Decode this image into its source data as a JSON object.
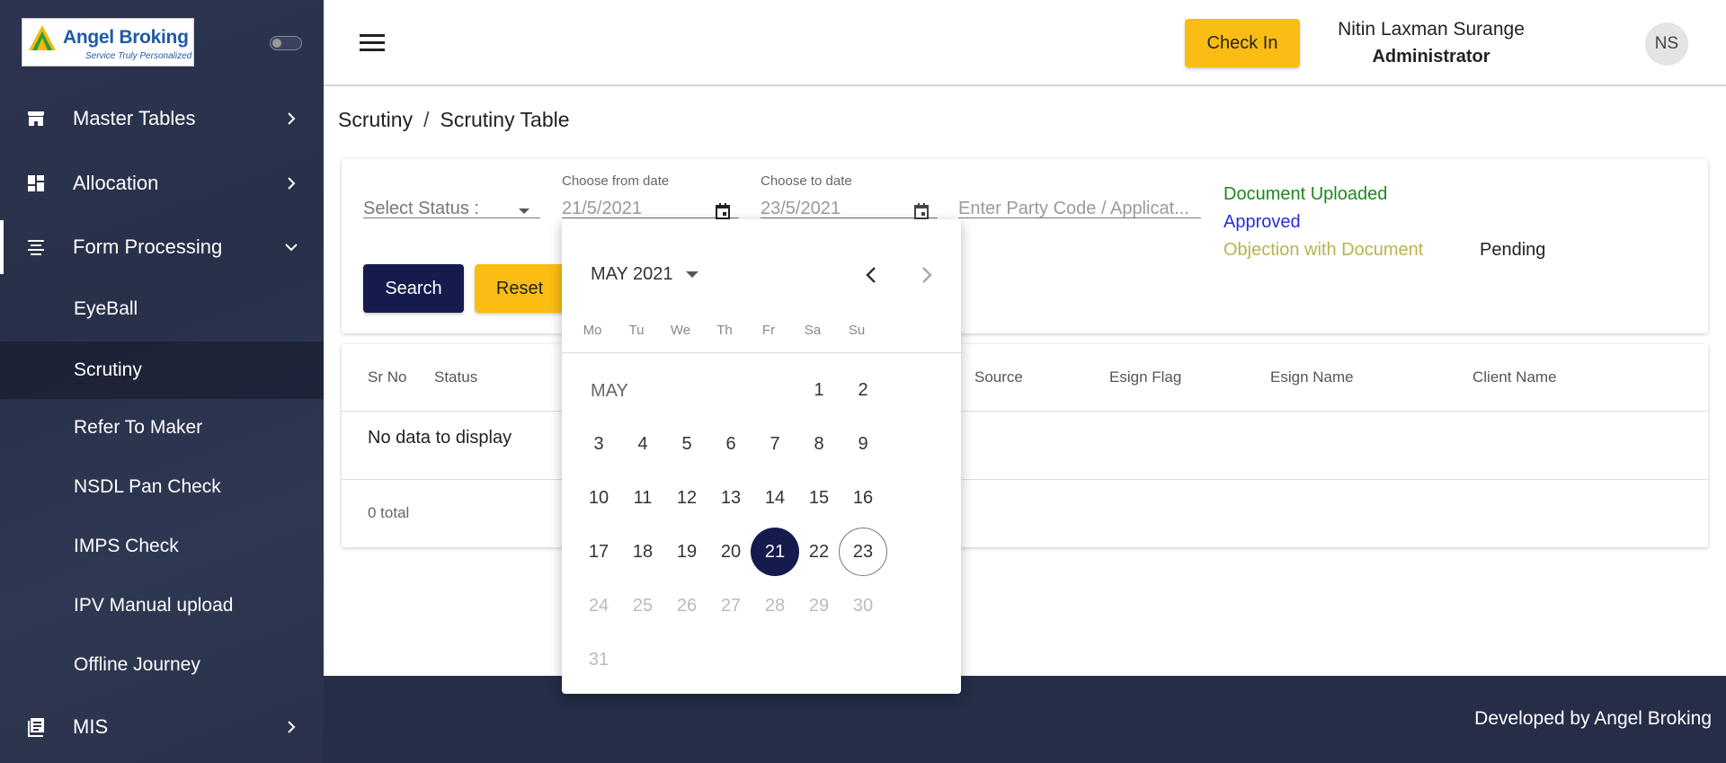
{
  "brand": {
    "name": "Angel Broking",
    "tagline": "Service Truly Personalized"
  },
  "sidebar": {
    "items": [
      {
        "label": "Master Tables",
        "icon": "store-icon"
      },
      {
        "label": "Allocation",
        "icon": "dashboard-icon"
      },
      {
        "label": "Form Processing",
        "icon": "form-icon"
      },
      {
        "label": "MIS",
        "icon": "report-icon"
      }
    ],
    "subitems": [
      {
        "label": "EyeBall"
      },
      {
        "label": "Scrutiny"
      },
      {
        "label": "Refer To Maker"
      },
      {
        "label": "NSDL Pan Check"
      },
      {
        "label": "IMPS Check"
      },
      {
        "label": "IPV Manual upload"
      },
      {
        "label": "Offline Journey"
      }
    ]
  },
  "header": {
    "checkin_label": "Check In",
    "user_name": "Nitin Laxman Surange",
    "user_role": "Administrator",
    "avatar_initials": "NS"
  },
  "breadcrumb": {
    "parent": "Scrutiny",
    "separator": "/",
    "current": "Scrutiny Table"
  },
  "filters": {
    "status_placeholder": "Select Status :",
    "from_label": "Choose from date",
    "from_value": "21/5/2021",
    "to_label": "Choose to date",
    "to_value": "23/5/2021",
    "party_placeholder": "Enter Party Code / Applicat...",
    "search_label": "Search",
    "reset_label": "Reset"
  },
  "legend": {
    "uploaded": "Document Uploaded",
    "approved": "Approved",
    "objection": "Objection with Document",
    "pending": "Pending",
    "colors": {
      "uploaded": "#1a8a1a",
      "approved": "#2b2bdc",
      "objection": "#b9b34a",
      "pending": "#222222"
    }
  },
  "table": {
    "columns": [
      "Sr No",
      "Status",
      "Source",
      "Esign Flag",
      "Esign Name",
      "Client Name"
    ],
    "empty_text": "No data to display",
    "total_text": "0 total"
  },
  "calendar": {
    "month_title": "MAY 2021",
    "month_label": "MAY",
    "weekdays": [
      "Mo",
      "Tu",
      "We",
      "Th",
      "Fr",
      "Sa",
      "Su"
    ],
    "weeks": [
      [
        "",
        "",
        "",
        "",
        "",
        "1",
        "2"
      ],
      [
        "3",
        "4",
        "5",
        "6",
        "7",
        "8",
        "9"
      ],
      [
        "10",
        "11",
        "12",
        "13",
        "14",
        "15",
        "16"
      ],
      [
        "17",
        "18",
        "19",
        "20",
        "21",
        "22",
        "23"
      ],
      [
        "24",
        "25",
        "26",
        "27",
        "28",
        "29",
        "30"
      ],
      [
        "31",
        "",
        "",
        "",
        "",
        "",
        ""
      ]
    ],
    "selected_day": "21",
    "today_day": "23",
    "last_enabled_day": 23
  },
  "footer": {
    "text": "Developed by Angel Broking"
  },
  "colors": {
    "sidebar_bg": "#2a3149",
    "accent_yellow": "#fbbd13",
    "primary_navy": "#151b4d"
  }
}
